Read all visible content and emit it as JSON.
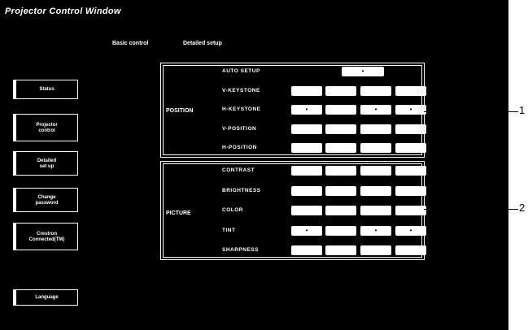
{
  "window": {
    "title": "Projector Control Window"
  },
  "top_tabs": [
    "Basic control",
    "Detailed setup"
  ],
  "sidebar": [
    {
      "label": "Status"
    },
    {
      "label": "Projector\ncontrol"
    },
    {
      "label": "Detailed\nset up"
    },
    {
      "label": "Change\npassword"
    },
    {
      "label": "Crestron\nConnected(TM)"
    },
    {
      "label": "Language"
    }
  ],
  "position_group": {
    "label": "POSITION",
    "rows": [
      {
        "label": "AUTO SETUP",
        "cells": [
          "•"
        ]
      },
      {
        "label": "V-KEYSTONE",
        "cells": [
          "",
          "",
          "",
          ""
        ]
      },
      {
        "label": "H-KEYSTONE",
        "cells": [
          "•",
          "",
          "•",
          "•"
        ]
      },
      {
        "label": "V-POSITION",
        "cells": [
          "",
          "",
          "",
          ""
        ]
      },
      {
        "label": "H-POSITION",
        "cells": [
          "",
          "",
          "",
          ""
        ]
      }
    ]
  },
  "picture_group": {
    "label": "PICTURE",
    "rows": [
      {
        "label": "CONTRAST",
        "cells": [
          "",
          "",
          "",
          ""
        ]
      },
      {
        "label": "BRIGHTNESS",
        "cells": [
          "",
          "",
          "",
          ""
        ]
      },
      {
        "label": "COLOR",
        "cells": [
          "",
          "",
          "",
          ""
        ]
      },
      {
        "label": "TINT",
        "cells": [
          "•",
          "",
          "•",
          "•"
        ]
      },
      {
        "label": "SHARPNESS",
        "cells": [
          "",
          "",
          "",
          ""
        ]
      }
    ]
  },
  "callouts": [
    "1",
    "2"
  ]
}
